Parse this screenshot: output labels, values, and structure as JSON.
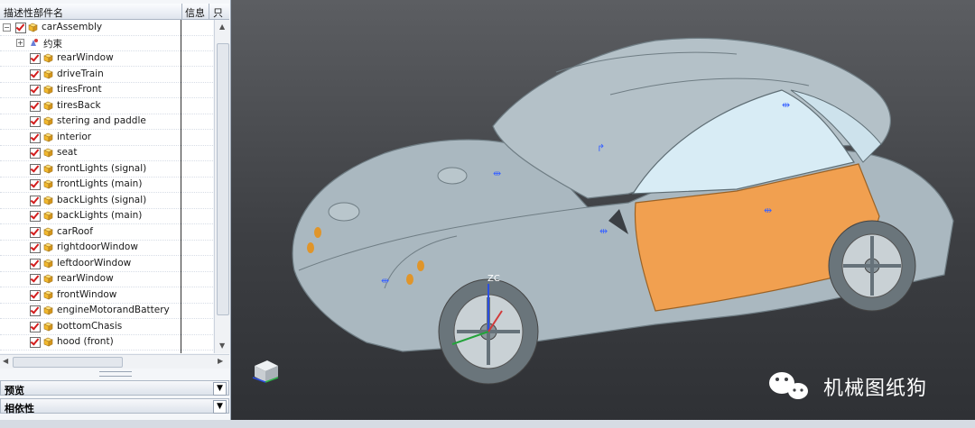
{
  "navigator": {
    "col_name": "描述性部件名",
    "col_info": "信息",
    "col_only": "只",
    "root": "carAssembly",
    "constraints": "约束",
    "items": [
      "rearWindow",
      "driveTrain",
      "tiresFront",
      "tiresBack",
      "stering and paddle",
      "interior",
      "seat",
      "frontLights (signal)",
      "frontLights (main)",
      "backLights (signal)",
      "backLights (main)",
      "carRoof",
      "rightdoorWindow",
      "leftdoorWindow",
      "rearWindow",
      "frontWindow",
      "engineMotorandBattery",
      "bottomChasis",
      "hood (front)"
    ]
  },
  "panels": {
    "preview": "预览",
    "dependency": "相依性"
  },
  "viewport": {
    "axis_label": "ZC",
    "watermark": "机械图纸狗",
    "body_color": "#aab8c0",
    "door_color": "#f1a050",
    "glass_color": "#d8ecf5"
  }
}
